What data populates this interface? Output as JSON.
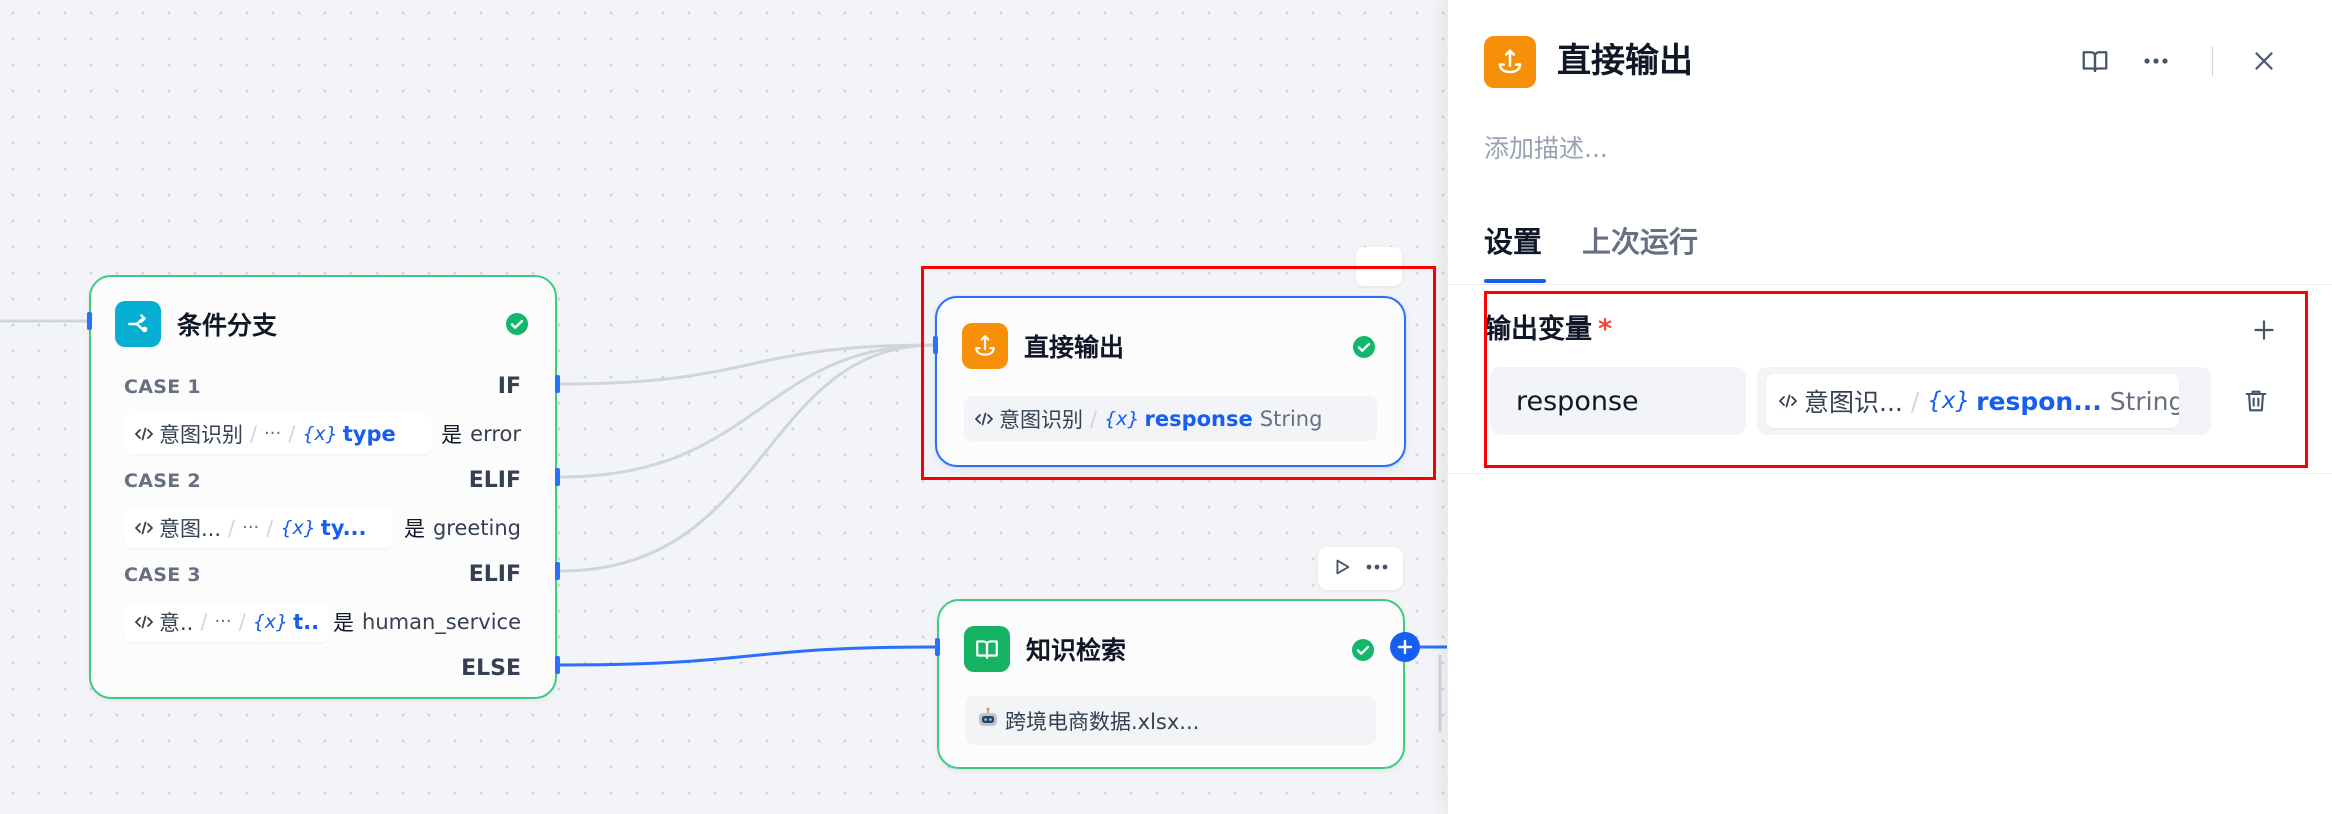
{
  "canvas": {
    "condition_node": {
      "title": "条件分支",
      "cases": [
        {
          "label": "CASE 1",
          "keyword": "IF",
          "source_node": "意图识别",
          "ellipsis": "···",
          "variable": "type",
          "operator": "是",
          "value": "error"
        },
        {
          "label": "CASE 2",
          "keyword": "ELIF",
          "source_node": "意图...",
          "ellipsis": "···",
          "variable": "ty...",
          "operator": "是",
          "value": "greeting"
        },
        {
          "label": "CASE 3",
          "keyword": "ELIF",
          "source_node": "意..",
          "ellipsis": "···",
          "variable": "t..",
          "operator": "是",
          "value": "human_service"
        }
      ],
      "else_label": "ELSE"
    },
    "output_node": {
      "title": "直接输出",
      "source_node": "意图识别",
      "variable": "response",
      "type": "String"
    },
    "knowledge_node": {
      "title": "知识检索",
      "dataset": "跨境电商数据.xlsx..."
    }
  },
  "glyphs": {
    "separator": "/",
    "variable": "{x}"
  },
  "panel": {
    "title": "直接输出",
    "description_placeholder": "添加描述...",
    "tabs": [
      {
        "label": "设置",
        "active": true
      },
      {
        "label": "上次运行",
        "active": false
      }
    ],
    "section_title": "输出变量",
    "required_mark": "*",
    "variables": [
      {
        "name": "response",
        "source_node": "意图识...",
        "variable": "respon...",
        "type": "String"
      }
    ]
  },
  "colors": {
    "accent": "#155EEF",
    "edge-blue": "#2970FF",
    "success": "#12B76A",
    "orange": "#F79009",
    "cyan": "#06AED4",
    "green": "#16B364",
    "green-border": "#3CCB7F",
    "highlight": "#FF0000"
  },
  "icons": {
    "condition_node": "if-else-icon",
    "output_node": "answer-icon",
    "knowledge_node": "knowledge-book-icon",
    "status": "success-check-icon",
    "panel_actions": [
      "help-book-icon",
      "more-dots-icon",
      "close-icon"
    ],
    "variable_actions": [
      "add-icon",
      "trash-icon"
    ]
  }
}
